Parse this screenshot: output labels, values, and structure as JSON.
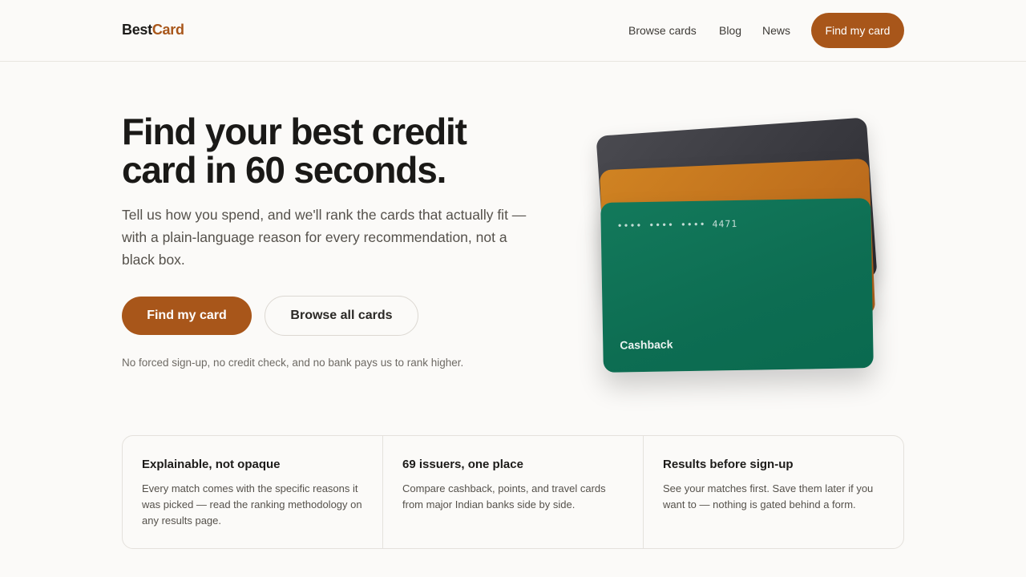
{
  "header": {
    "logo_main": "Best",
    "logo_accent": "Card",
    "nav": [
      {
        "label": "Browse cards"
      },
      {
        "label": "Blog"
      },
      {
        "label": "News"
      }
    ],
    "cta_label": "Find my card"
  },
  "hero": {
    "title": "Find your best credit card in 60 seconds.",
    "description": "Tell us how you spend, and we'll rank the cards that actually fit — with a plain-language reason for every recommendation, not a black box.",
    "primary_button": "Find my card",
    "secondary_button": "Browse all cards",
    "note": "No forced sign-up, no credit check, and no bank pays us to rank higher."
  },
  "card_stack": {
    "front_card_number": "•••• •••• •••• 4471",
    "front_card_label": "Cashback",
    "colors": {
      "back": "#3e3e44",
      "middle": "#c4721e",
      "front": "#0f7356"
    }
  },
  "features": [
    {
      "title": "Explainable, not opaque",
      "text": "Every match comes with the specific reasons it was picked — read the ranking methodology on any results page."
    },
    {
      "title": "69 issuers, one place",
      "text": "Compare cashback, points, and travel cards from major Indian banks side by side."
    },
    {
      "title": "Results before sign-up",
      "text": "See your matches first. Save them later if you want to — nothing is gated behind a form."
    }
  ],
  "theme": {
    "accent": "#a8561a",
    "background": "#fbfaf8",
    "text": "#1c1b19"
  }
}
